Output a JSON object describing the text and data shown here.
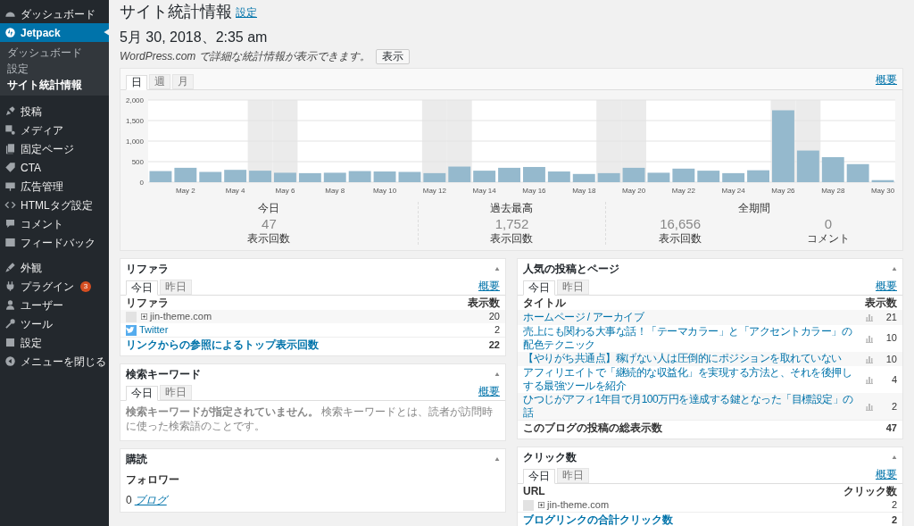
{
  "sidebar": {
    "groups": [
      [
        {
          "label": "ダッシュボード",
          "selected": false
        },
        {
          "label": "Jetpack",
          "selected": true,
          "children": [
            {
              "label": "ダッシュボード",
              "selected": false
            },
            {
              "label": "設定",
              "selected": false
            },
            {
              "label": "サイト統計情報",
              "selected": true
            }
          ]
        }
      ],
      [
        {
          "label": "投稿",
          "selected": false
        },
        {
          "label": "メディア",
          "selected": false
        },
        {
          "label": "固定ページ",
          "selected": false
        },
        {
          "label": "CTA",
          "selected": false
        },
        {
          "label": "広告管理",
          "selected": false
        },
        {
          "label": "HTMLタグ設定",
          "selected": false
        },
        {
          "label": "コメント",
          "selected": false
        },
        {
          "label": "フィードバック",
          "selected": false
        }
      ],
      [
        {
          "label": "外観",
          "selected": false
        },
        {
          "label": "プラグイン",
          "selected": false,
          "badge": "3"
        },
        {
          "label": "ユーザー",
          "selected": false
        },
        {
          "label": "ツール",
          "selected": false
        },
        {
          "label": "設定",
          "selected": false
        },
        {
          "label": "メニューを閉じる",
          "selected": false
        }
      ]
    ]
  },
  "header": {
    "title": "サイト統計情報",
    "settings_link": "設定",
    "date": "5月 30, 2018、2:35 am",
    "notice": "WordPress.com で詳細な統計情報が表示できます。",
    "button": "表示"
  },
  "chart_panel": {
    "tabs": [
      {
        "label": "日",
        "selected": true
      },
      {
        "label": "週",
        "selected": false
      },
      {
        "label": "月",
        "selected": false
      }
    ],
    "summary_link": "概要",
    "chart_data": {
      "type": "bar",
      "categories": [
        null,
        "May 2",
        null,
        "May 4",
        null,
        "May 6",
        null,
        "May 8",
        null,
        "May 10",
        null,
        "May 12",
        null,
        "May 14",
        null,
        "May 16",
        null,
        "May 18",
        null,
        "May 20",
        null,
        "May 22",
        null,
        "May 24",
        null,
        "May 26",
        null,
        "May 28",
        null,
        "May 30"
      ],
      "values": [
        270,
        350,
        250,
        300,
        280,
        230,
        220,
        230,
        270,
        260,
        250,
        220,
        380,
        280,
        350,
        370,
        260,
        200,
        220,
        350,
        230,
        330,
        280,
        220,
        290,
        1750,
        770,
        610,
        440,
        50
      ],
      "ylim": [
        0,
        2000
      ],
      "grid": true,
      "yticks": [
        0,
        500,
        {
          "value": 1000,
          "label": "1,000"
        },
        {
          "value": 1500,
          "label": "1,500"
        },
        {
          "value": 2000,
          "label": "2,000"
        }
      ]
    },
    "stats": [
      {
        "heading": "今日",
        "figures": [
          {
            "value": "47",
            "label": "表示回数"
          }
        ]
      },
      {
        "heading": "過去最高",
        "figures": [
          {
            "value": "1,752",
            "label": "表示回数"
          }
        ]
      },
      {
        "heading": "全期間",
        "figures": [
          {
            "value": "16,656",
            "label": "表示回数"
          },
          {
            "value": "0",
            "label": "コメント"
          }
        ]
      }
    ]
  },
  "referrers": {
    "title": "リファラ",
    "tabs": [
      {
        "label": "今日",
        "selected": true
      },
      {
        "label": "昨日",
        "selected": false
      }
    ],
    "summary_link": "概要",
    "columns": [
      "リファラ",
      "表示数"
    ],
    "rows": [
      {
        "kind": "domain",
        "label": "jin-theme.com",
        "value": "20"
      },
      {
        "kind": "twitter",
        "label": "Twitter",
        "value": "2"
      }
    ],
    "total": {
      "label": "リンクからの参照によるトップ表示回数",
      "value": "22"
    }
  },
  "search_terms": {
    "title": "検索キーワード",
    "tabs": [
      {
        "label": "今日",
        "selected": true
      },
      {
        "label": "昨日",
        "selected": false
      }
    ],
    "summary_link": "概要",
    "message": "**検索キーワードが指定されていません。** 検索キーワードとは、読者が訪問時に使った検索語のことです。"
  },
  "subscriptions": {
    "title": "購読",
    "heading": "フォロワー",
    "rows": [
      {
        "count": "0",
        "label": "ブログ"
      }
    ]
  },
  "top_posts": {
    "title": "人気の投稿とページ",
    "tabs": [
      {
        "label": "今日",
        "selected": true
      },
      {
        "label": "昨日",
        "selected": false
      }
    ],
    "summary_link": "概要",
    "columns": [
      "タイトル",
      "表示数"
    ],
    "rows": [
      {
        "title": "ホームページ / アーカイブ",
        "value": "21"
      },
      {
        "title": "売上にも関わる大事な話！「テーマカラー」と「アクセントカラー」の配色テクニック",
        "value": "10"
      },
      {
        "title": "【やりがち共通点】稼げない人は圧倒的にポジションを取れていない",
        "value": "10"
      },
      {
        "title": "アフィリエイトで「継続的な収益化」を実現する方法と、それを後押しする最強ツールを紹介",
        "value": "4"
      },
      {
        "title": "ひつじがアフィ1年目で月100万円を達成する鍵となった「目標設定」の話",
        "value": "2"
      }
    ],
    "total": {
      "label": "このブログの投稿の総表示数",
      "value": "47"
    }
  },
  "clicks": {
    "title": "クリック数",
    "tabs": [
      {
        "label": "今日",
        "selected": true
      },
      {
        "label": "昨日",
        "selected": false
      }
    ],
    "summary_link": "概要",
    "columns": [
      "URL",
      "クリック数"
    ],
    "rows": [
      {
        "label": "jin-theme.com",
        "value": "2"
      }
    ],
    "total": {
      "label": "ブログリンクの合計クリック数",
      "value": "2"
    }
  }
}
